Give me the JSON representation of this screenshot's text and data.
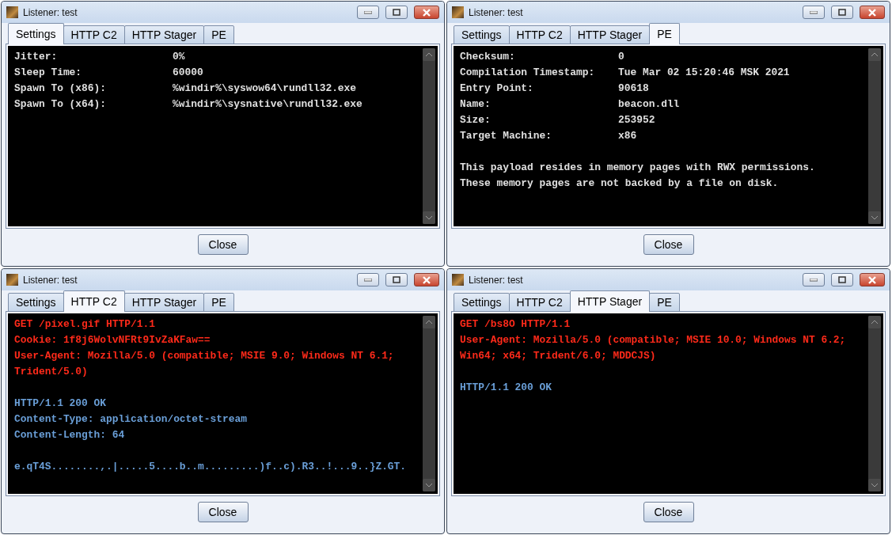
{
  "windows": [
    {
      "title": "Listener: test",
      "tabs": [
        {
          "label": "Settings",
          "selected": true
        },
        {
          "label": "HTTP C2",
          "selected": false
        },
        {
          "label": "HTTP Stager",
          "selected": false
        },
        {
          "label": "PE",
          "selected": false
        }
      ],
      "lines": [
        {
          "kind": "pair",
          "label": "Jitter:",
          "value": "0%"
        },
        {
          "kind": "pair",
          "label": "Sleep Time:",
          "value": "60000"
        },
        {
          "kind": "pair",
          "label": "Spawn To (x86):",
          "value": "%windir%\\syswow64\\rundll32.exe"
        },
        {
          "kind": "pair",
          "label": "Spawn To (x64):",
          "value": "%windir%\\sysnative\\rundll32.exe"
        }
      ],
      "button": "Close"
    },
    {
      "title": "Listener: test",
      "tabs": [
        {
          "label": "Settings",
          "selected": false
        },
        {
          "label": "HTTP C2",
          "selected": false
        },
        {
          "label": "HTTP Stager",
          "selected": false
        },
        {
          "label": "PE",
          "selected": true
        }
      ],
      "lines": [
        {
          "kind": "pair",
          "label": "Checksum:",
          "value": "0"
        },
        {
          "kind": "pair",
          "label": "Compilation Timestamp:",
          "value": "Tue Mar 02 15:20:46 MSK 2021"
        },
        {
          "kind": "pair",
          "label": "Entry Point:",
          "value": "90618"
        },
        {
          "kind": "pair",
          "label": "Name:",
          "value": "beacon.dll"
        },
        {
          "kind": "pair",
          "label": "Size:",
          "value": "253952"
        },
        {
          "kind": "pair",
          "label": "Target Machine:",
          "value": "x86"
        },
        {
          "kind": "blank"
        },
        {
          "kind": "text",
          "text": "This payload resides in memory pages with RWX permissions.",
          "color": "#e0e0e0"
        },
        {
          "kind": "text",
          "text": "These memory pages are not backed by a file on disk.",
          "color": "#e0e0e0"
        }
      ],
      "button": "Close"
    },
    {
      "title": "Listener: test",
      "tabs": [
        {
          "label": "Settings",
          "selected": false
        },
        {
          "label": "HTTP C2",
          "selected": true
        },
        {
          "label": "HTTP Stager",
          "selected": false
        },
        {
          "label": "PE",
          "selected": false
        }
      ],
      "lines": [
        {
          "kind": "text",
          "text": "GET /pixel.gif HTTP/1.1",
          "color": "#ff2a1a"
        },
        {
          "kind": "text",
          "text": "Cookie: 1f8j6WolvNFRt9IvZaKFaw==",
          "color": "#ff2a1a"
        },
        {
          "kind": "text",
          "text": "User-Agent: Mozilla/5.0 (compatible; MSIE 9.0; Windows NT 6.1;",
          "color": "#ff2a1a"
        },
        {
          "kind": "text",
          "text": "Trident/5.0)",
          "color": "#ff2a1a"
        },
        {
          "kind": "blank"
        },
        {
          "kind": "text",
          "text": "HTTP/1.1 200 OK",
          "color": "#6a9fd8"
        },
        {
          "kind": "text",
          "text": "Content-Type: application/octet-stream",
          "color": "#6a9fd8"
        },
        {
          "kind": "text",
          "text": "Content-Length: 64",
          "color": "#6a9fd8"
        },
        {
          "kind": "blank"
        },
        {
          "kind": "text",
          "text": "e.qT4S........,.|.....5....b..m.........)f..c).R3..!...9..}Z.GT.",
          "color": "#6a9fd8"
        }
      ],
      "button": "Close"
    },
    {
      "title": "Listener: test",
      "tabs": [
        {
          "label": "Settings",
          "selected": false
        },
        {
          "label": "HTTP C2",
          "selected": false
        },
        {
          "label": "HTTP Stager",
          "selected": true
        },
        {
          "label": "PE",
          "selected": false
        }
      ],
      "lines": [
        {
          "kind": "text",
          "text": "GET /bs8O HTTP/1.1",
          "color": "#ff2a1a"
        },
        {
          "kind": "text",
          "text": "User-Agent: Mozilla/5.0 (compatible; MSIE 10.0; Windows NT 6.2;",
          "color": "#ff2a1a"
        },
        {
          "kind": "text",
          "text": "Win64; x64; Trident/6.0; MDDCJS)",
          "color": "#ff2a1a"
        },
        {
          "kind": "blank"
        },
        {
          "kind": "text",
          "text": "HTTP/1.1 200 OK",
          "color": "#6a9fd8"
        }
      ],
      "button": "Close"
    }
  ]
}
